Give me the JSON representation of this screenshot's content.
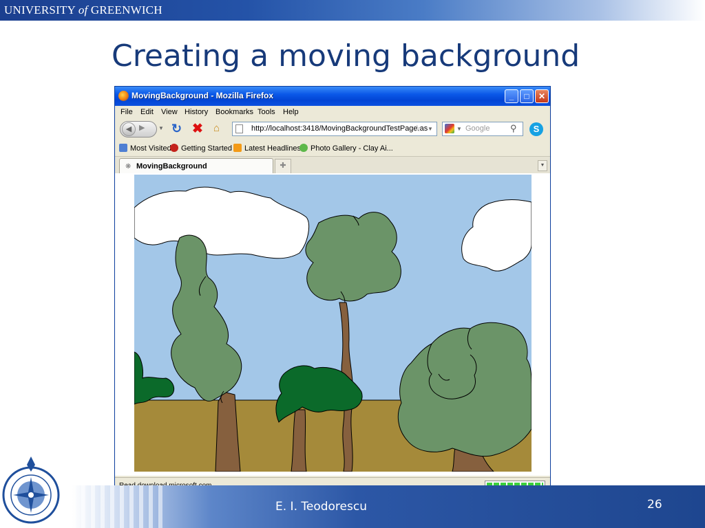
{
  "slide": {
    "university": {
      "pre": "UNIVERSITY",
      "of": "of",
      "post": "GREENWICH"
    },
    "title": "Creating a moving background",
    "author": "E. I. Teodorescu",
    "page_number": "26"
  },
  "browser": {
    "window_title": "MovingBackground - Mozilla Firefox",
    "menu": [
      "File",
      "Edit",
      "View",
      "History",
      "Bookmarks",
      "Tools",
      "Help"
    ],
    "url": "http://localhost:3418/MovingBackgroundTestPage.as",
    "search_placeholder": "Google",
    "bookmarks": [
      "Most Visited",
      "Getting Started",
      "Latest Headlines",
      "Photo Gallery - Clay Ai..."
    ],
    "tab_label": "MovingBackground",
    "status_text": "Read download.microsoft.com",
    "progress": 1.0
  },
  "colors": {
    "sky": "#a3c7e8",
    "ground": "#a58a3a",
    "tree_light": "#6b9468",
    "tree_dark": "#0b6a2a",
    "trunk": "#86603e",
    "title_blue": "#173a7a"
  },
  "icons": [
    "firefox-icon",
    "back-icon",
    "forward-icon",
    "reload-icon",
    "stop-icon",
    "home-icon",
    "page-icon",
    "bookmark-star-icon",
    "google-icon",
    "magnifier-icon",
    "skype-icon",
    "rss-icon",
    "spinner-icon",
    "new-tab-icon"
  ]
}
